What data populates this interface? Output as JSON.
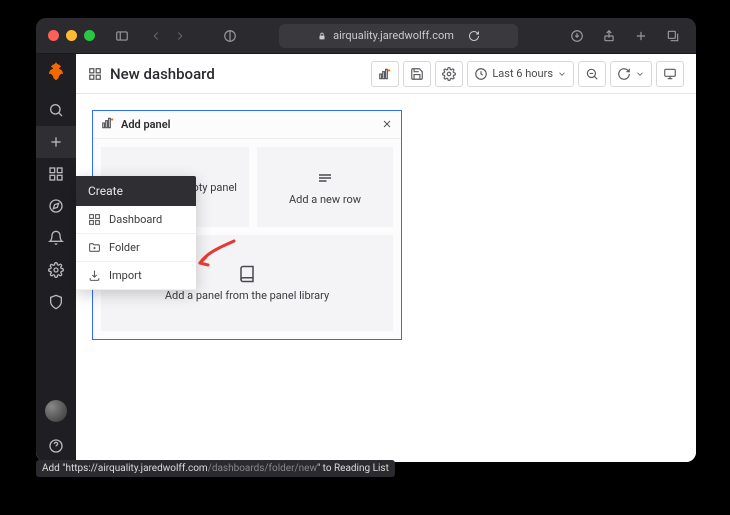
{
  "browser": {
    "url_host": "airquality.jaredwolff.com"
  },
  "tooltip": {
    "prefix": "Add \"https://airquality.jaredwolff.com",
    "dim": "/dashboards/folder/new",
    "suffix": "\" to Reading List"
  },
  "page": {
    "title": "New dashboard",
    "time_range": "Last 6 hours"
  },
  "sidebar": {
    "items": [
      "search",
      "create",
      "dashboards",
      "explore",
      "alerting",
      "configuration",
      "admin"
    ]
  },
  "create_menu": {
    "title": "Create",
    "items": [
      {
        "icon": "grid",
        "label": "Dashboard"
      },
      {
        "icon": "folder",
        "label": "Folder"
      },
      {
        "icon": "import",
        "label": "Import"
      }
    ]
  },
  "add_panel": {
    "title": "Add panel",
    "empty_panel_label": "Add an empty panel",
    "empty_panel_visible_tail": "oty panel",
    "new_row_label": "Add a new row",
    "library_label": "Add a panel from the panel library"
  }
}
